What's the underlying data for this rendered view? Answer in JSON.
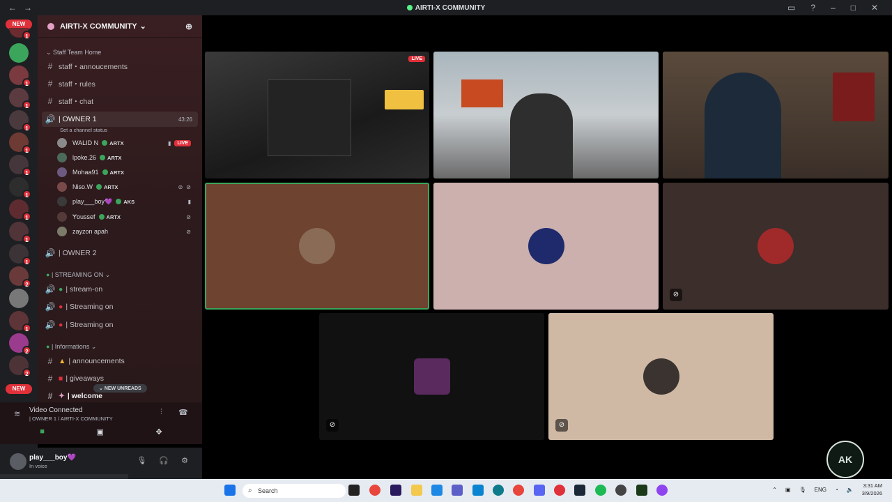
{
  "window": {
    "title": "AIRTI-X COMMUNITY"
  },
  "server": {
    "name": "AIRTI-X COMMUNITY"
  },
  "guilds": {
    "new_top": "NEW",
    "new_bottom": "NEW",
    "badges": [
      "1",
      "1",
      "1",
      "1",
      "1",
      "1",
      "1",
      "1",
      "1",
      "1",
      "1",
      "2",
      "1",
      "1",
      "1",
      "2",
      "1",
      "2"
    ]
  },
  "channels": {
    "cat_staff": "Staff Team Home",
    "staff_announcements": "staff・annoucements",
    "staff_rules": "staff・rules",
    "staff_chat": "staff・chat",
    "owner1": "| OWNER 1",
    "owner1_time": "43:26",
    "set_status": "Set a channel status",
    "owner2": "| OWNER 2",
    "cat_streaming": "| STREAMING ON",
    "stream_on": "| stream-on",
    "streaming_on_1": "| Streaming on",
    "streaming_on_2": "| Streaming on",
    "cat_info": "| Informations",
    "announcements": "| announcements",
    "giveaways": "| giveaways",
    "welcome": "| welcome",
    "new_unreads": "NEW UNREADS"
  },
  "voice_users": [
    {
      "name": "WALID N",
      "tag": "ARTX",
      "live": "LIVE"
    },
    {
      "name": "lpoke.26",
      "tag": "ARTX"
    },
    {
      "name": "Mohaa91",
      "tag": "ARTX"
    },
    {
      "name": "Niso.W",
      "tag": "ARTX"
    },
    {
      "name": "play___boy💜",
      "tag": "AKS"
    },
    {
      "name": "Ɏoussef",
      "tag": "ARTX"
    },
    {
      "name": "zayzon apah",
      "tag": ""
    }
  ],
  "voice_panel": {
    "status": "Video Connected",
    "location": "| OWNER 1 / AIRTI-X COMMUNITY"
  },
  "user": {
    "name": "play___boy💜",
    "status": "In voice"
  },
  "stage": {
    "live_label": "LIVE"
  },
  "taskbar": {
    "search_placeholder": "Search",
    "lang": "ENG",
    "time": "3:31 AM",
    "date": "3/9/2026"
  },
  "watermark": "AK",
  "colors": {
    "accent": "#3ba55c",
    "danger": "#e0303a",
    "tile_brown": "#6e432f",
    "tile_pink": "#cbb0ae",
    "tile_dark": "#3b2e2b",
    "tile_beige": "#cfb9a4"
  }
}
